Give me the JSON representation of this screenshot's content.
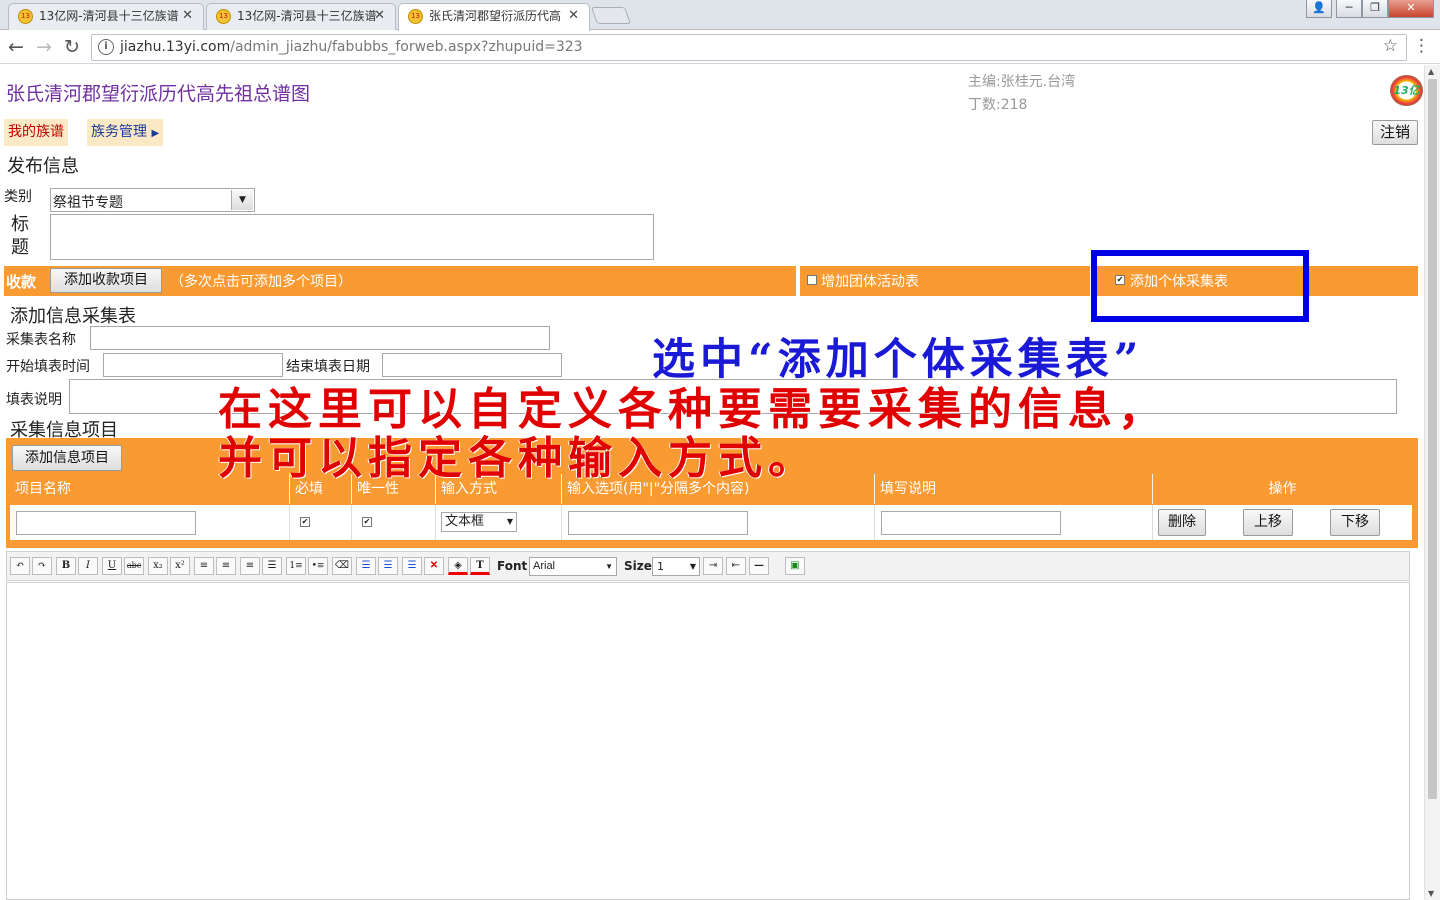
{
  "browser": {
    "tabs": [
      {
        "title": "13亿网-清河县十三亿族谱"
      },
      {
        "title": "13亿网-清河县十三亿族谱"
      },
      {
        "title": "张氏清河郡望衍派历代高"
      }
    ],
    "favicon_text": "13",
    "tab_close": "✕",
    "url_domain": "jiazhu.13yi.com",
    "url_path": "/admin_jiazhu/fabubbs_forweb.aspx?zhupuid=323",
    "window_buttons": {
      "user": "👤",
      "minimize": "─",
      "restore": "❐",
      "close": "✕"
    }
  },
  "header": {
    "site_title": "张氏清河郡望衍派历代高先祖总谱图",
    "editor_line": "主编:张桂元.台湾",
    "count_line": "丁数:218",
    "logo_text": "13亿"
  },
  "menu": {
    "my_genealogy": "我的族谱",
    "clan_management": "族务管理",
    "logout": "注销"
  },
  "form": {
    "section_title": "发布信息",
    "category_label": "类别",
    "category_value": "祭祖节专题",
    "title_label": "标题",
    "title_value": "",
    "collection": {
      "label": "收款",
      "add_button": "添加收款项目",
      "hint": "（多次点击可添加多个项目）",
      "group_activity_checkbox": "增加团体活动表",
      "group_activity_checked": false,
      "individual_form_checkbox": "添加个体采集表",
      "individual_form_checked": true
    },
    "info_form": {
      "title": "添加信息采集表",
      "name_label": "采集表名称",
      "start_label": "开始填表时间",
      "end_label": "结束填表日期",
      "desc_label": "填表说明",
      "items_title": "采集信息项目",
      "add_item_button": "添加信息项目",
      "columns": [
        "项目名称",
        "必填",
        "唯一性",
        "输入方式",
        "输入选项(用\"|\"分隔多个内容)",
        "填写说明",
        "操作"
      ],
      "row": {
        "required_checked": true,
        "unique_checked": true,
        "input_type": "文本框",
        "delete_button": "删除",
        "up_button": "上移",
        "down_button": "下移"
      }
    }
  },
  "editor_toolbar": {
    "font_label": "Font",
    "font_value": "Arial",
    "size_label": "Size",
    "size_value": "1",
    "buttons": [
      "undo-icon",
      "redo-icon",
      "bold-icon",
      "italic-icon",
      "underline-icon",
      "strikethrough-icon",
      "subscript-icon",
      "superscript-icon",
      "align-left-icon",
      "align-center-icon",
      "align-right-icon",
      "align-justify-icon",
      "ordered-list-icon",
      "unordered-list-icon",
      "eraser-icon",
      "indent-block-icon",
      "outdent-block-icon",
      "clear-format-icon",
      "delete-icon",
      "fill-color-icon",
      "text-color-icon",
      "increase-indent-icon",
      "decrease-indent-icon",
      "horizontal-rule-icon",
      "insert-image-icon"
    ]
  },
  "annotations": {
    "blue_text": "选中“添加个体采集表”",
    "red_line1": "在这里可以自定义各种要需要采集的信息，",
    "red_line2": "并可以指定各种输入方式。",
    "highlight_color": "#0000e6",
    "red_color": "#e00000"
  }
}
